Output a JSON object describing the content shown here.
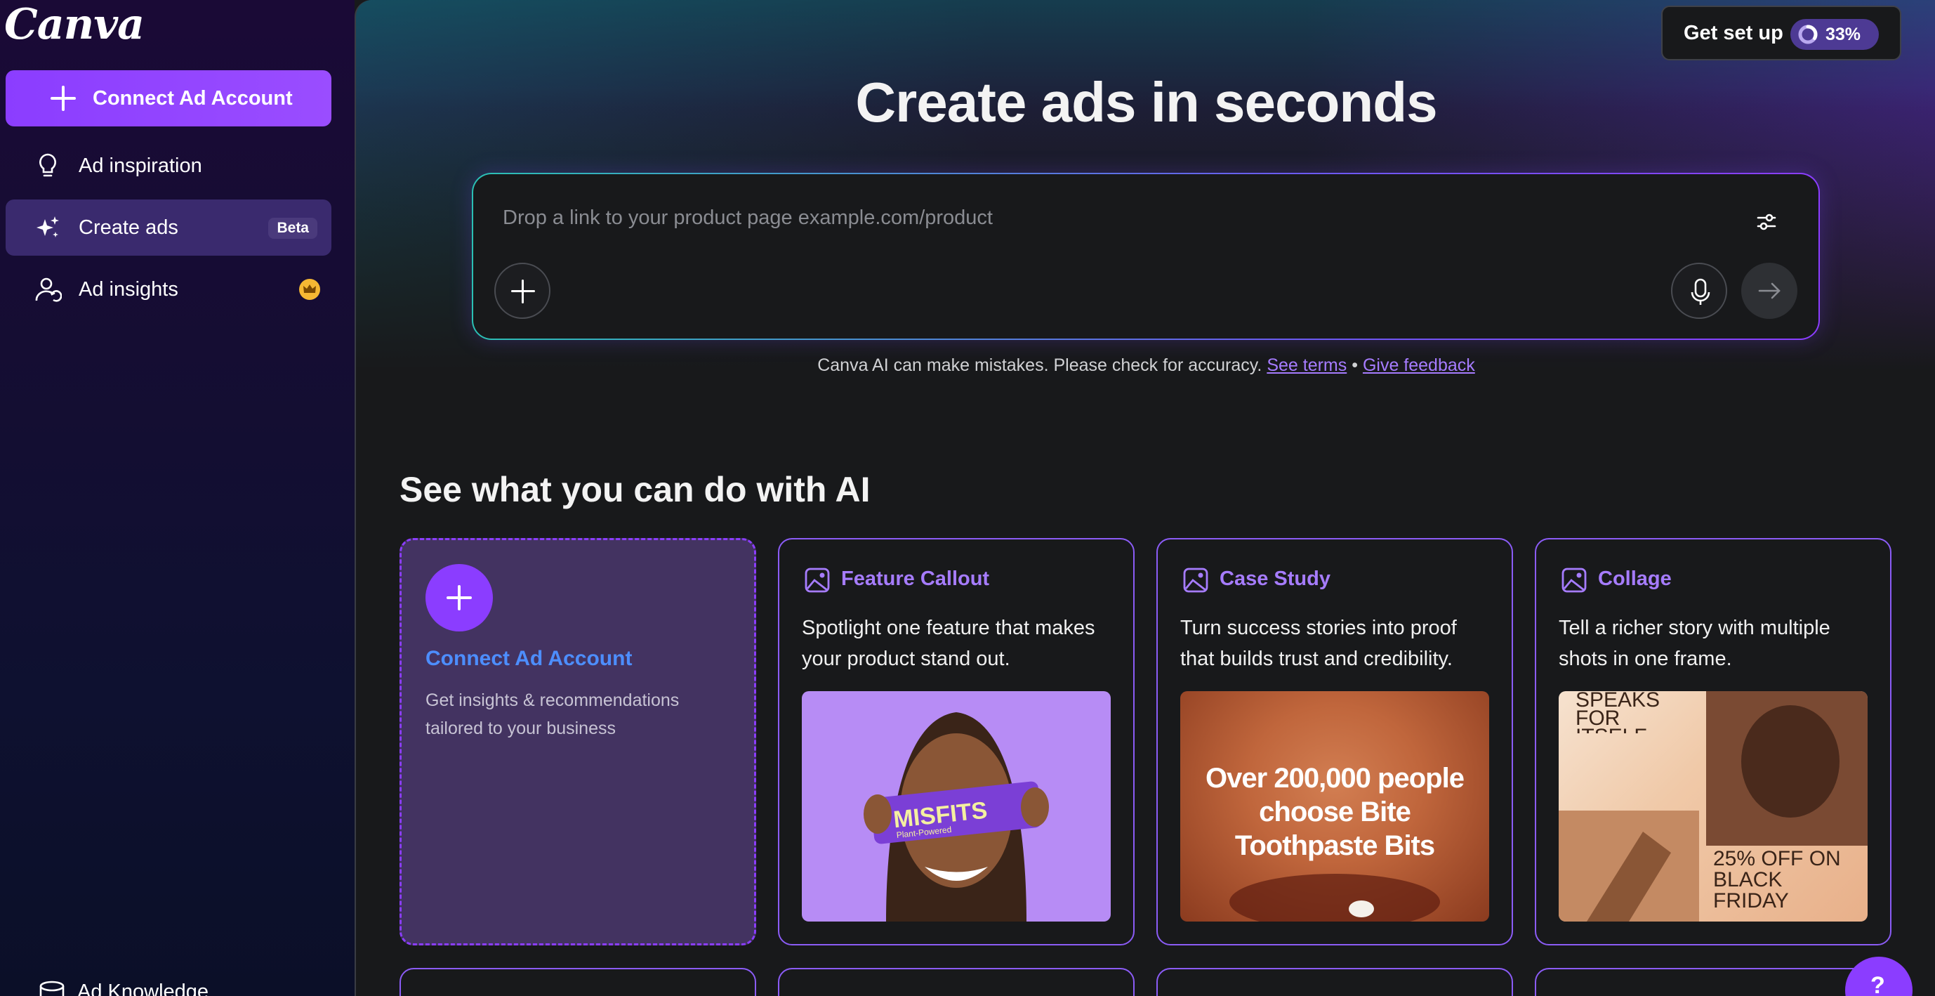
{
  "app": {
    "logo": "Canva"
  },
  "sidebar": {
    "connect_label": "Connect Ad Account",
    "items": [
      {
        "label": "Ad inspiration",
        "icon": "lightbulb-icon"
      },
      {
        "label": "Create ads",
        "icon": "sparkle-icon",
        "badge": "Beta",
        "active": true
      },
      {
        "label": "Ad insights",
        "icon": "user-refresh-icon",
        "badge_icon": "crown-icon"
      }
    ],
    "bottom_item": {
      "label": "Ad Knowledge",
      "icon": "database-icon"
    }
  },
  "header": {
    "setup_label": "Get set up",
    "setup_progress": "33%",
    "setup_progress_value": 0.33
  },
  "hero": {
    "title": "Create ads in seconds",
    "prompt_placeholder": "Drop a link to your product page example.com/product",
    "disclaimer_text": "Canva AI can make mistakes. Please check for accuracy.",
    "terms_link": "See terms",
    "separator": "•",
    "feedback_link": "Give feedback"
  },
  "section": {
    "title": "See what you can do with AI",
    "connect_card": {
      "title": "Connect Ad Account",
      "description": "Get insights & recommendations tailored to your business"
    },
    "cards": [
      {
        "title": "Feature Callout",
        "description": "Spotlight one feature that makes your product stand out.",
        "image_text": "MISFITS",
        "image_subtext": "Plant-Powered"
      },
      {
        "title": "Case Study",
        "description": "Turn success stories into proof that builds trust and credibility.",
        "image_text": "Over 200,000 people choose Bite Toothpaste Bits"
      },
      {
        "title": "Collage",
        "description": "Tell a richer story with multiple shots in one frame.",
        "image_text_top": "SPEAKS FOR ITSELF",
        "image_text_bottom": "25% OFF ON BLACK FRIDAY"
      }
    ]
  },
  "help": {
    "label": "?"
  },
  "colors": {
    "accent": "#8b3dff",
    "link": "#a67cff",
    "connect_title": "#4d8eff"
  }
}
